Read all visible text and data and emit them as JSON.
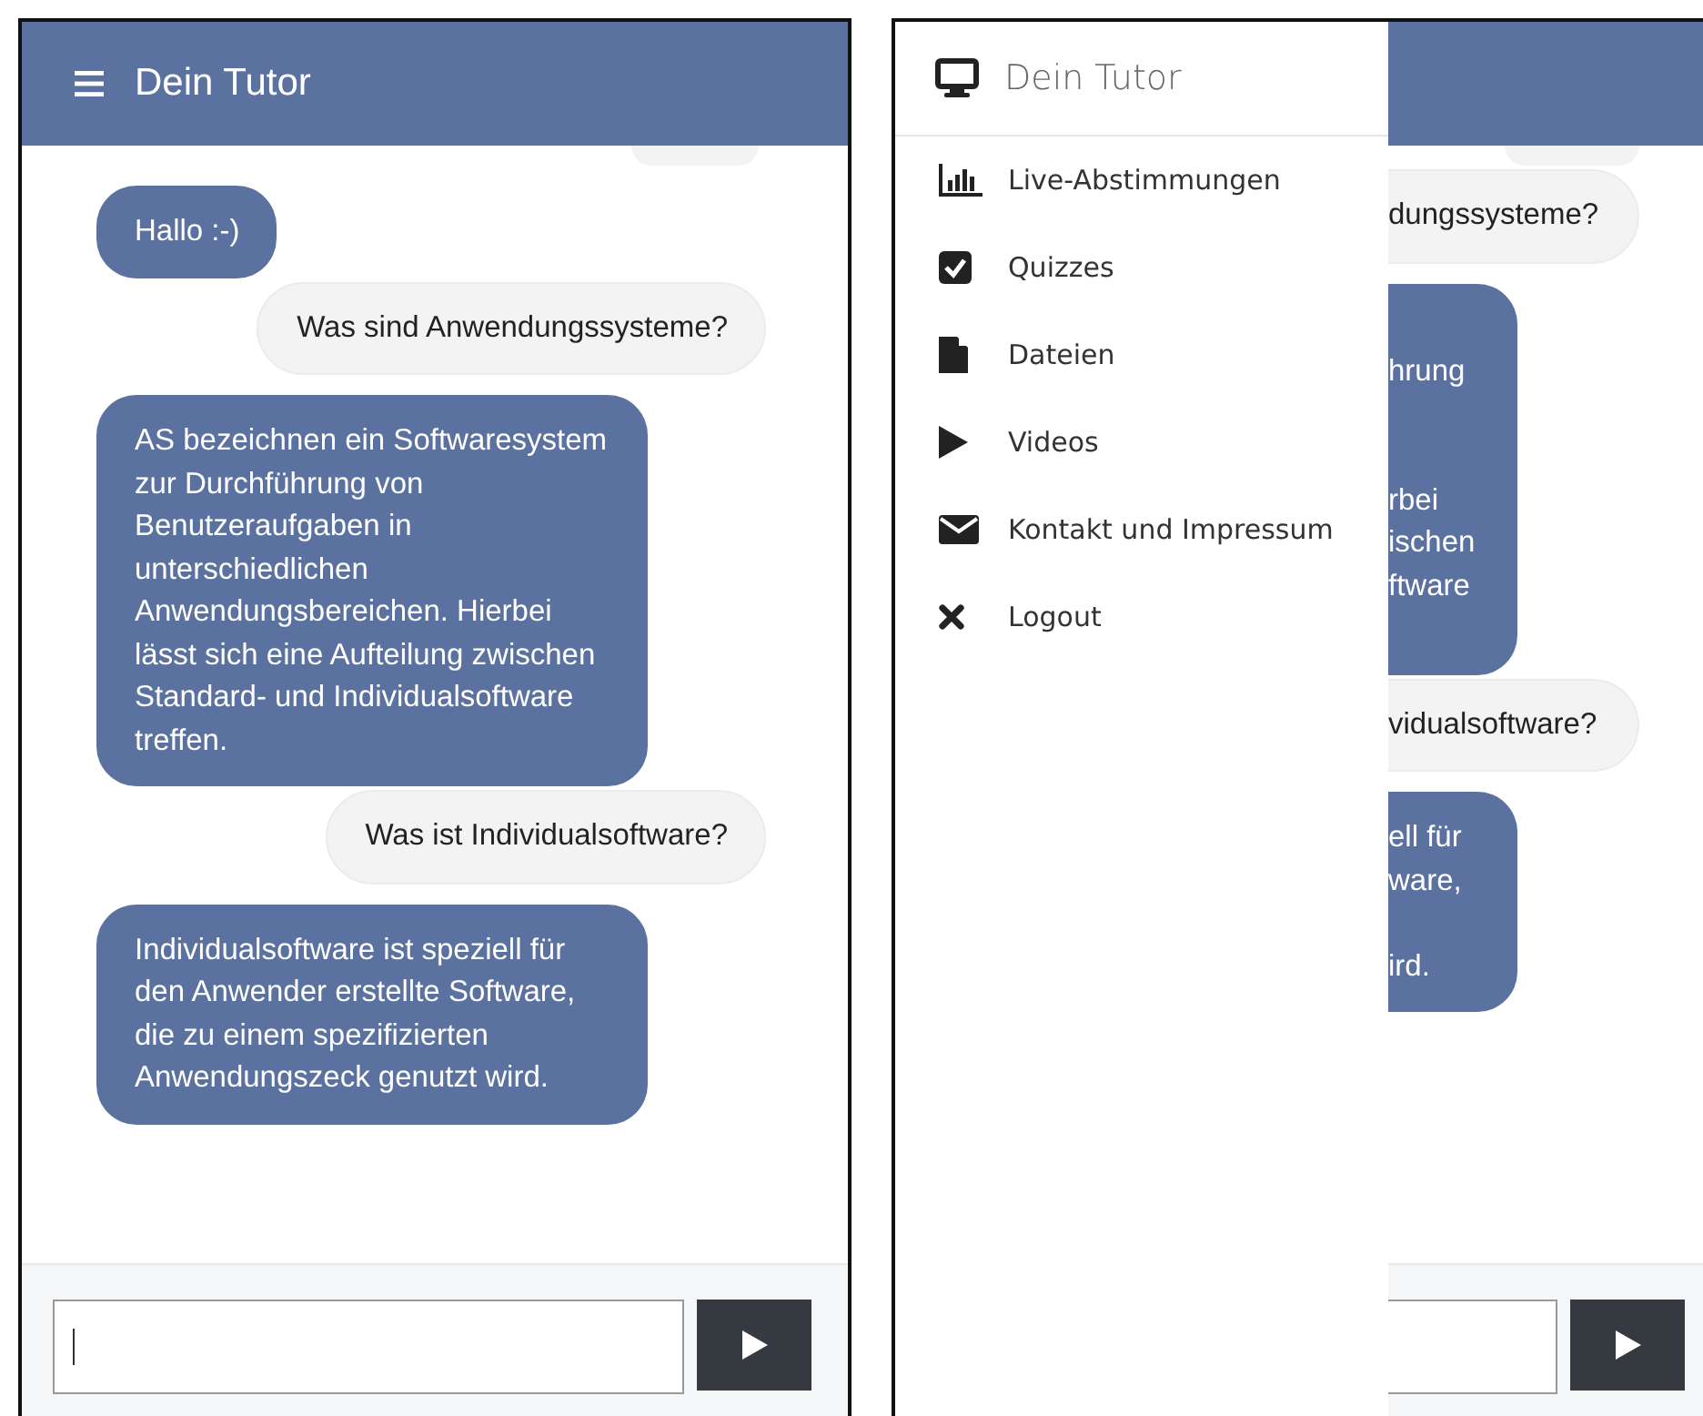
{
  "screens": [
    {
      "kind": "chat",
      "header": {
        "title": "Dein Tutor"
      },
      "messages": [
        {
          "kind": "bot",
          "text": "Hallo :-)"
        },
        {
          "kind": "user",
          "text": "Was sind Anwendungssysteme?"
        },
        {
          "kind": "bot",
          "text": "AS bezeichnen ein Softwaresystem zur Durchführung von Benutzeraufgaben in unterschiedlichen Anwendungsbereichen. Hierbei lässt sich eine Aufteilung zwischen Standard- und Individualsoftware treffen."
        },
        {
          "kind": "user",
          "text": "Was ist Individualsoftware?"
        },
        {
          "kind": "bot",
          "text": "Individualsoftware ist speziell für den Anwender erstellte Software, die zu einem spezifizierten Anwendungszeck genutzt wird."
        }
      ]
    },
    {
      "kind": "drawer_open",
      "drawer": {
        "title": "Dein Tutor",
        "items": [
          {
            "label": "Live-Abstimmungen"
          },
          {
            "label": "Quizzes"
          },
          {
            "label": "Dateien"
          },
          {
            "label": "Videos"
          },
          {
            "label": "Kontakt und Impressum"
          },
          {
            "label": "Logout"
          }
        ]
      },
      "messages": [
        {
          "kind": "user",
          "lines": [
            {
              "kind": "text",
              "text": "dungssysteme?"
            }
          ]
        },
        {
          "kind": "bot",
          "lines": [
            {
              "kind": "hidden"
            },
            {
              "kind": "text",
              "text": "hrung"
            },
            {
              "kind": "hidden"
            },
            {
              "kind": "hidden"
            },
            {
              "kind": "text",
              "text": "rbei"
            },
            {
              "kind": "text",
              "text": "ischen"
            },
            {
              "kind": "text",
              "text": "ftware"
            },
            {
              "kind": "hidden"
            }
          ]
        },
        {
          "kind": "user",
          "lines": [
            {
              "kind": "text",
              "text": "vidualsoftware?"
            }
          ]
        },
        {
          "kind": "bot",
          "lines": [
            {
              "kind": "text",
              "text": "ell für"
            },
            {
              "kind": "text",
              "text": "ware,"
            },
            {
              "kind": "hidden"
            },
            {
              "kind": "text",
              "text": "ird."
            }
          ]
        }
      ]
    }
  ]
}
